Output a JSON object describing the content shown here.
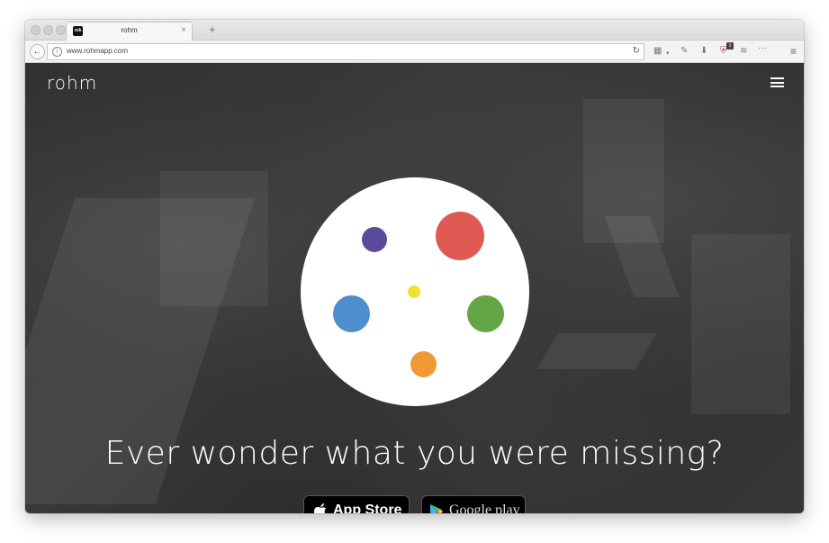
{
  "browser": {
    "tab_title": "rohm",
    "favicon_text": "rok",
    "tab_close": "×",
    "new_tab": "+",
    "back": "←",
    "info": "i",
    "url": "www.rohmapp.com",
    "reload": "↻",
    "badge_count": "1",
    "menu": "≡",
    "toolbar_icons": [
      "reader-view-icon",
      "dropdown-icon",
      "wrench-icon",
      "download-icon",
      "shield-addon-icon",
      "pocket-icon",
      "overflow-icon"
    ]
  },
  "page": {
    "logo": "rohm",
    "headline": "Ever wonder what you were missing?",
    "app_store_label": "App Store",
    "google_play_label": "Google play",
    "dot_colors": {
      "purple": "#5b4a9b",
      "red": "#e05a54",
      "yellow": "#f2e035",
      "blue": "#4f8ecc",
      "green": "#63a646",
      "orange": "#ef9a35"
    }
  }
}
